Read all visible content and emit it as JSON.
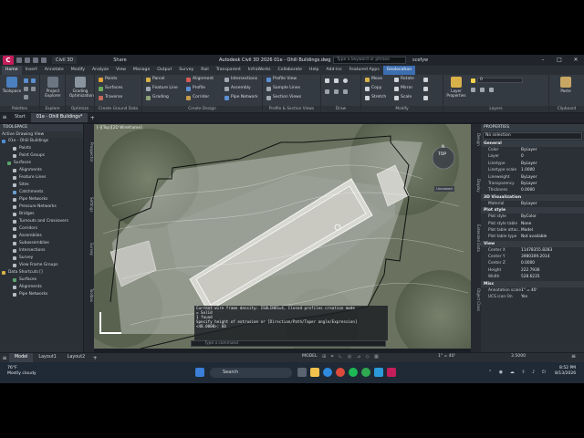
{
  "titlebar": {
    "app_logo": "C",
    "product": "Civil 3D",
    "share": "Share",
    "title": "Autodesk Civil 3D 2026   01e - Ohill Buildings.dwg",
    "search_placeholder": "Type a keyword or phrase",
    "user": "scefyw"
  },
  "ribbon_tabs": [
    "Home",
    "Insert",
    "Annotate",
    "Modify",
    "Analyze",
    "View",
    "Manage",
    "Output",
    "Survey",
    "Rail",
    "Transparent",
    "InfraWorks",
    "Collaborate",
    "Help",
    "Add-ins",
    "Featured Apps",
    "Geolocation"
  ],
  "ribbon": {
    "palettes": {
      "title": "Palettes",
      "toolspace": "Toolspace"
    },
    "explore": {
      "title": "Explore",
      "project_explorer": "Project Explorer"
    },
    "optimize": {
      "title": "Optimize",
      "grading": "Grading Optimization"
    },
    "create_ground": {
      "title": "Create Ground Data",
      "points": "Points",
      "surfaces": "Surfaces",
      "traverse": "Traverse"
    },
    "create_design": {
      "title": "Create Design",
      "parcel": "Parcel",
      "feature_line": "Feature Line",
      "grading": "Grading",
      "alignment": "Alignment",
      "profile": "Profile",
      "corridor": "Corridor",
      "intersections": "Intersections",
      "assembly": "Assembly",
      "pipe_network": "Pipe Network"
    },
    "profile_section": {
      "title": "Profile & Section Views",
      "profile_view": "Profile View",
      "sample_lines": "Sample Lines",
      "section_views": "Section Views"
    },
    "draw": {
      "title": "Draw"
    },
    "modify": {
      "title": "Modify",
      "move": "Move",
      "copy": "Copy",
      "stretch": "Stretch",
      "rotate": "Rotate",
      "mirror": "Mirror",
      "scale": "Scale"
    },
    "layers": {
      "title": "Layers",
      "layer_properties": "Layer Properties",
      "layer_value": "0"
    },
    "clipboard": {
      "title": "Clipboard",
      "paste": "Paste"
    }
  },
  "doc_tabs": [
    "Start",
    "01e - Ohill Buildings*"
  ],
  "toolspace": {
    "title": "TOOLSPACE",
    "subtitle": "Active Drawing View",
    "tree": [
      {
        "label": "01e - Ohill Buildings",
        "color": "#4f8fd6"
      },
      {
        "label": "Points",
        "color": "#b5bcc5"
      },
      {
        "label": "Point Groups",
        "color": "#b5bcc5"
      },
      {
        "label": "Surfaces",
        "color": "#5aa36b"
      },
      {
        "label": "Alignments",
        "color": "#b5bcc5"
      },
      {
        "label": "Feature Lines",
        "color": "#b5bcc5"
      },
      {
        "label": "Sites",
        "color": "#b5bcc5"
      },
      {
        "label": "Catchments",
        "color": "#6a9fd0"
      },
      {
        "label": "Pipe Networks",
        "color": "#b5bcc5"
      },
      {
        "label": "Pressure Networks",
        "color": "#b5bcc5"
      },
      {
        "label": "Bridges",
        "color": "#b5bcc5"
      },
      {
        "label": "Turnouts and Crossovers",
        "color": "#b5bcc5"
      },
      {
        "label": "Corridors",
        "color": "#b5bcc5"
      },
      {
        "label": "Assemblies",
        "color": "#b5bcc5"
      },
      {
        "label": "Subassemblies",
        "color": "#b5bcc5"
      },
      {
        "label": "Intersections",
        "color": "#b5bcc5"
      },
      {
        "label": "Survey",
        "color": "#b5bcc5"
      },
      {
        "label": "View Frame Groups",
        "color": "#b5bcc5"
      },
      {
        "label": "Data Shortcuts []",
        "color": "#d8b34a"
      },
      {
        "label": "Surfaces",
        "color": "#5aa36b"
      },
      {
        "label": "Alignments",
        "color": "#b5bcc5"
      },
      {
        "label": "Pipe Networks",
        "color": "#b5bcc5"
      }
    ],
    "side_tabs": [
      "Prospector",
      "Settings",
      "Survey",
      "Toolbox"
    ]
  },
  "viewport": {
    "label": "[-][Top][2D Wireframe]",
    "compass": {
      "n": "N",
      "top": "TOP",
      "s": "S"
    },
    "wcs": "Unnamed",
    "command_history": [
      "Current wire frame density: ISOLINES=4, Closed profiles creation mode",
      "= Solid",
      "1 found",
      "Specify height of extrusion or [Direction/Path/Taper angle/Expression]",
      "<48.0000>: 60"
    ],
    "command_placeholder": "Type a command"
  },
  "properties": {
    "title": "PROPERTIES",
    "selection": "No selection",
    "side_tabs": [
      "Design",
      "Display",
      "Extended Data",
      "Object Class"
    ],
    "sections": [
      {
        "name": "General",
        "rows": [
          {
            "k": "Color",
            "v": "ByLayer"
          },
          {
            "k": "Layer",
            "v": "0"
          },
          {
            "k": "Linetype",
            "v": "ByLayer"
          },
          {
            "k": "Linetype scale",
            "v": "1.0000"
          },
          {
            "k": "Lineweight",
            "v": "ByLayer"
          },
          {
            "k": "Transparency",
            "v": "ByLayer"
          },
          {
            "k": "Thickness",
            "v": "0.0000"
          }
        ]
      },
      {
        "name": "3D Visualization",
        "rows": [
          {
            "k": "Material",
            "v": "ByLayer"
          }
        ]
      },
      {
        "name": "Plot style",
        "rows": [
          {
            "k": "Plot style",
            "v": "ByColor"
          },
          {
            "k": "Plot style table",
            "v": "None"
          },
          {
            "k": "Plot table attac...",
            "v": "Model"
          },
          {
            "k": "Plot table type",
            "v": "Not available"
          }
        ]
      },
      {
        "name": "View",
        "rows": [
          {
            "k": "Center X",
            "v": "11478355.8283"
          },
          {
            "k": "Center Y",
            "v": "3980309.2014"
          },
          {
            "k": "Center Z",
            "v": "0.0000"
          },
          {
            "k": "Height",
            "v": "222.7936"
          },
          {
            "k": "Width",
            "v": "528.6235"
          }
        ]
      },
      {
        "name": "Misc",
        "rows": [
          {
            "k": "Annotation scale",
            "v": "1\" = 40'"
          },
          {
            "k": "UCS icon On",
            "v": "Yes"
          }
        ]
      }
    ]
  },
  "statusbar": {
    "tabs": [
      "Model",
      "Layout1",
      "Layout2"
    ],
    "model": "MODEL",
    "scale": "1\" = 40'",
    "zoom": "3.5000"
  },
  "taskbar": {
    "temp": "76°F",
    "weather": "Mostly cloudy",
    "search": "Search",
    "time": "8:52 PM",
    "date": "8/13/2026"
  }
}
